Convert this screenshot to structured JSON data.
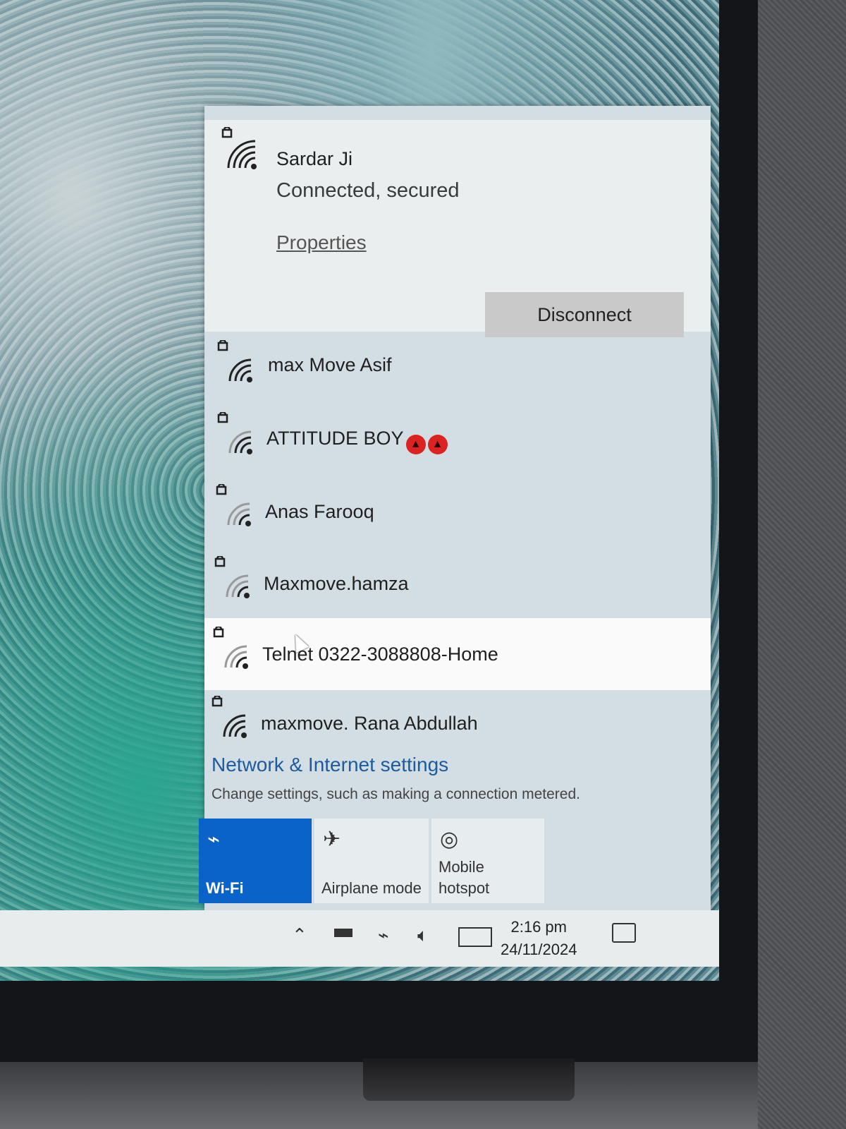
{
  "connected_network": {
    "ssid": "Sardar Ji",
    "status": "Connected, secured",
    "properties_label": "Properties",
    "disconnect_label": "Disconnect"
  },
  "networks": [
    {
      "ssid": "max Move Asif",
      "secured": true
    },
    {
      "ssid": "ATTITUDE BOY",
      "secured": true,
      "suffix_emoji": [
        "devil-face",
        "devil-face"
      ]
    },
    {
      "ssid": "Anas Farooq",
      "secured": true
    },
    {
      "ssid": "Maxmove.hamza",
      "secured": true
    },
    {
      "ssid": "Telnet 0322-3088808-Home",
      "secured": true,
      "highlighted": true
    },
    {
      "ssid": "maxmove. Rana Abdullah",
      "secured": true
    }
  ],
  "settings": {
    "link_label": "Network & Internet settings",
    "description": "Change settings, such as making a connection metered."
  },
  "quick_actions": [
    {
      "label": "Wi-Fi",
      "icon": "wifi-icon",
      "active": true
    },
    {
      "label": "Airplane mode",
      "icon": "airplane-icon",
      "active": false
    },
    {
      "label_line1": "Mobile",
      "label_line2": "hotspot",
      "icon": "hotspot-icon",
      "active": false
    }
  ],
  "taskbar": {
    "time": "2:16 pm",
    "date": "24/11/2024"
  },
  "colors": {
    "accent": "#0a63c9",
    "link": "#1d5a9e"
  }
}
